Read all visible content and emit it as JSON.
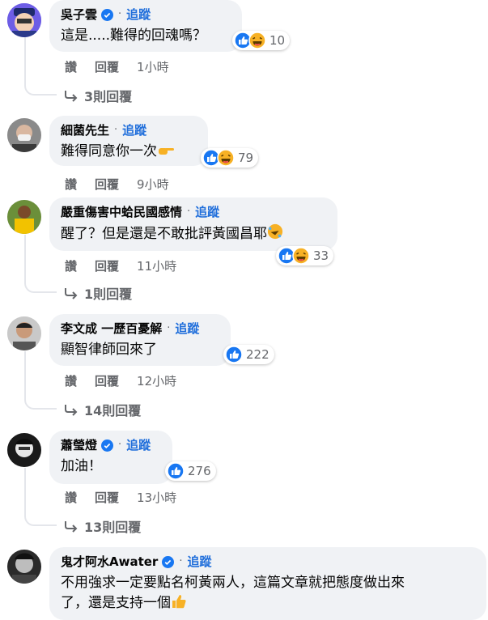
{
  "follow_label": "追蹤",
  "actions": {
    "like": "讚",
    "reply": "回覆"
  },
  "comments": [
    {
      "author": "吳子雲",
      "verified": true,
      "text": "這是.....難得的回魂嗎？",
      "reaction_count": "10",
      "time": "1小時",
      "replies": "3則回覆"
    },
    {
      "author": "細菌先生",
      "verified": false,
      "text": "難得同意你一次",
      "reaction_count": "79",
      "time": "9小時",
      "replies": ""
    },
    {
      "author": "嚴重傷害中蛤民國感情",
      "verified": false,
      "text": "醒了？但是還是不敢批評黃國昌耶",
      "reaction_count": "33",
      "time": "11小時",
      "replies": "1則回覆"
    },
    {
      "author": "李文成 一歷百憂解",
      "verified": false,
      "text": "顯智律師回來了",
      "reaction_count": "222",
      "time": "12小時",
      "replies": "14則回覆"
    },
    {
      "author": "蕭瑩燈",
      "verified": true,
      "text": "加油！",
      "reaction_count": "276",
      "time": "13小時",
      "replies": "13則回覆"
    },
    {
      "author": "鬼才阿水Awater",
      "verified": true,
      "text_line1": "不用強求一定要點名柯黃兩人，這篇文章就把態度做出來",
      "text_line2": "了，還是支持一個"
    }
  ],
  "colors": {
    "bubble": "#f0f2f5",
    "follow": "#216fdb",
    "muted": "#65676b",
    "like_blue": "#1877f2",
    "haha_yellow": "#f7b125"
  }
}
